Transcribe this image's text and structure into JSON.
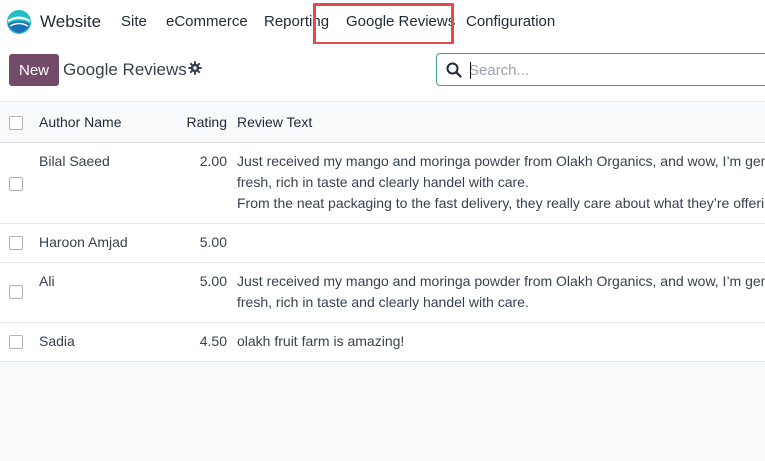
{
  "navbar": {
    "app_name": "Website",
    "menu": [
      "Site",
      "eCommerce",
      "Reporting",
      "Google Reviews",
      "Configuration"
    ]
  },
  "controls": {
    "new_label": "New",
    "title": "Google Reviews",
    "search_placeholder": "Search..."
  },
  "table": {
    "columns": [
      "Author Name",
      "Rating",
      "Review Text"
    ],
    "rows": [
      {
        "author": "Bilal Saeed",
        "rating": "2.00",
        "text_lines": [
          "Just received my mango and moringa powder from Olakh Organics, and wow, I’m gen",
          "fresh, rich in taste and clearly handel with care.",
          "From the neat packaging to the fast delivery, they really care about what they’re offerin"
        ]
      },
      {
        "author": "Haroon Amjad",
        "rating": "5.00",
        "text_lines": []
      },
      {
        "author": "Ali",
        "rating": "5.00",
        "text_lines": [
          "Just received my mango and moringa powder from Olakh Organics, and wow, I’m gen",
          "fresh, rich in taste and clearly handel with care."
        ]
      },
      {
        "author": "Sadia",
        "rating": "4.50",
        "text_lines": [
          "olakh fruit farm is amazing!"
        ]
      }
    ]
  },
  "colors": {
    "brand": "#714b67",
    "highlight": "#e04b4b",
    "search_border": "#3f9e9a"
  }
}
